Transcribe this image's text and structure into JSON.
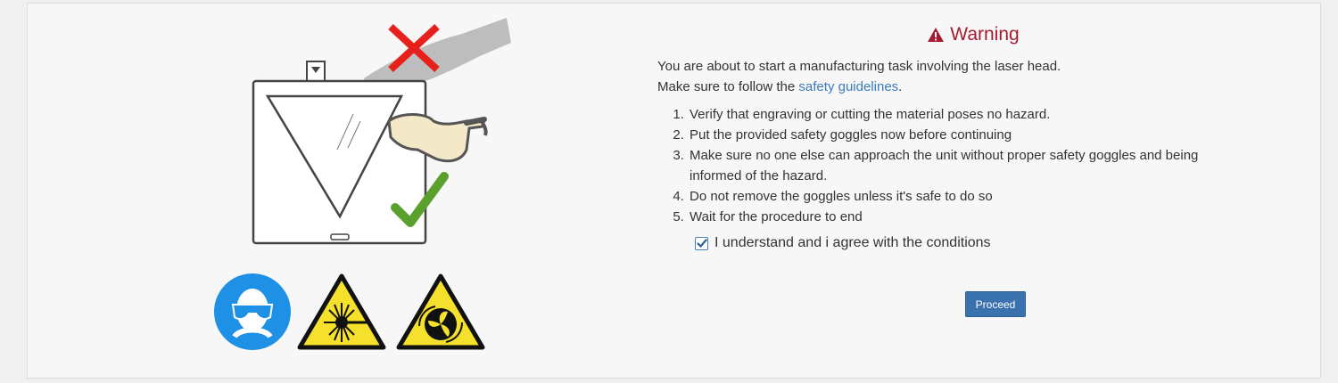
{
  "warning": {
    "title": "Warning",
    "icon": "warning-triangle-icon",
    "color": "#a51c30"
  },
  "intro": {
    "line1": "You are about to start a manufacturing task involving the laser head.",
    "line2_prefix": "Make sure to follow the ",
    "link": "safety guidelines",
    "line2_suffix": "."
  },
  "steps": [
    "Verify that engraving or cutting the material poses no hazard.",
    "Put the provided safety goggles now before continuing",
    "Make sure no one else can approach the unit without proper safety goggles and being informed of the hazard.",
    "Do not remove the goggles unless it's safe to do so",
    "Wait for the procedure to end"
  ],
  "agreement": {
    "label": "I understand and i agree with the conditions",
    "checked": true
  },
  "proceed_label": "Proceed",
  "icons": [
    "laser-unit-illustration-icon",
    "safety-goggles-icon",
    "hand-cross-icon",
    "check-mark-icon",
    "eye-protection-sign-icon",
    "laser-hazard-sign-icon",
    "fan-hazard-sign-icon"
  ]
}
